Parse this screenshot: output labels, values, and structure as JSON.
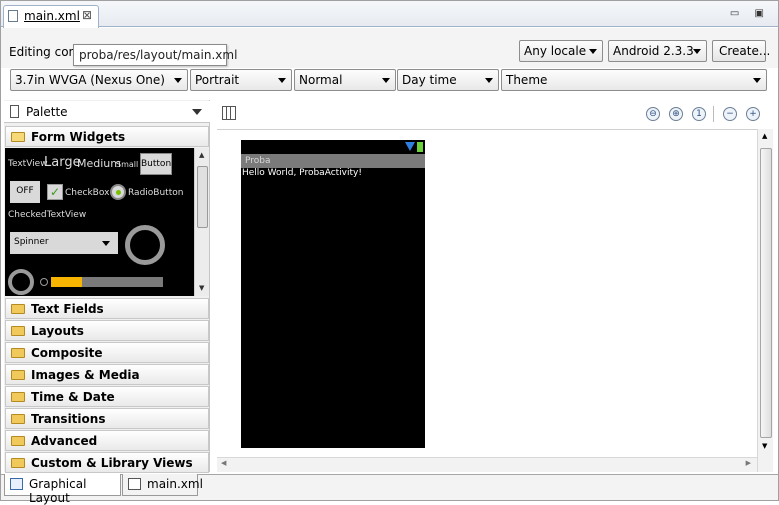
{
  "editor_tab": {
    "label": "main.xml",
    "close": "⊠"
  },
  "window_buttons": "▭ ▣",
  "toolbar": {
    "editing_label": "Editing con",
    "tooltip": "proba/res/layout/main.xml",
    "locale": "Any locale",
    "api": "Android 2.3.3",
    "create": "Create...",
    "device": "3.7in WVGA (Nexus One)",
    "orientation": "Portrait",
    "dock": "Normal",
    "time": "Day time",
    "theme": "Theme"
  },
  "palette": {
    "title": "Palette",
    "open_category": "Form Widgets",
    "categories": [
      "Text Fields",
      "Layouts",
      "Composite",
      "Images & Media",
      "Time & Date",
      "Transitions",
      "Advanced",
      "Custom & Library Views"
    ],
    "widgets": {
      "textview": "TextView",
      "large": "Large",
      "medium": "Medium",
      "small": "Small",
      "button": "Button",
      "toggle": "OFF",
      "checkbox": "CheckBox",
      "radio": "RadioButton",
      "checked_textview": "CheckedTextView",
      "spinner": "Spinner",
      "progress": 0.28
    }
  },
  "preview": {
    "app_title": "Proba",
    "body_text": "Hello World, ProbaActivity!"
  },
  "bottom_tabs": [
    "Graphical Layout",
    "main.xml"
  ],
  "colors": {
    "selected_tab_border": "#9fb2c7",
    "progress_fill": "#f7b400",
    "phone_bg": "#000000"
  }
}
